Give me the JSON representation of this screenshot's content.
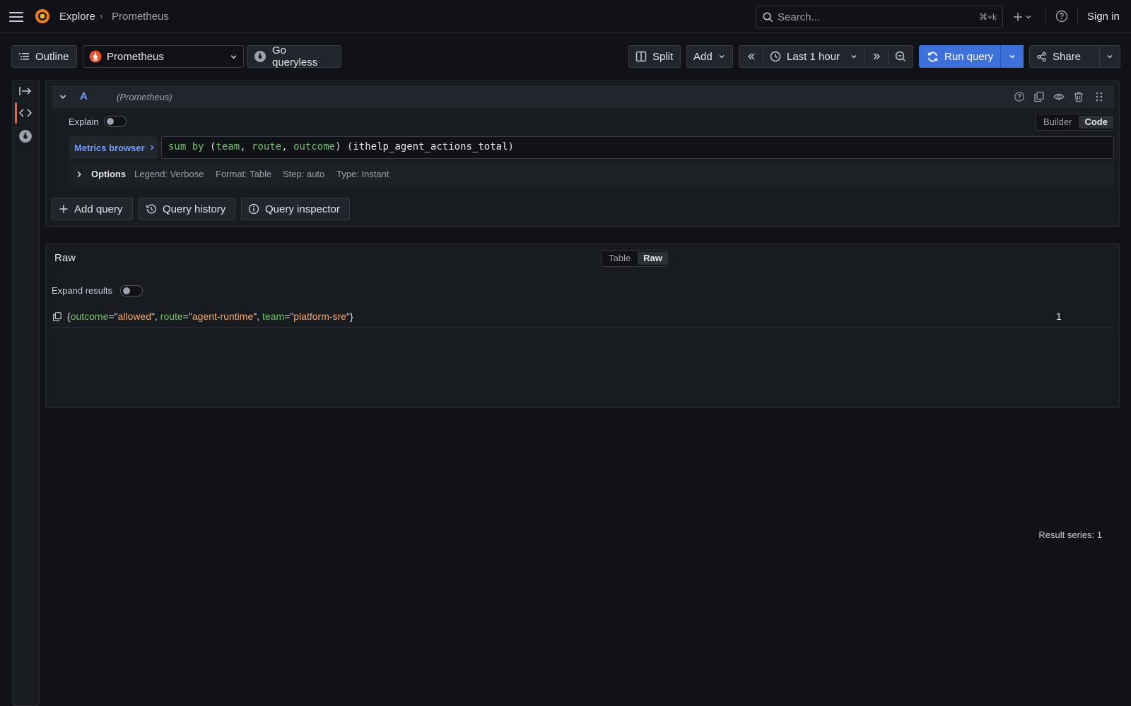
{
  "nav": {
    "breadcrumb": [
      "Explore",
      "Prometheus"
    ],
    "breadcrumb_sep": "›",
    "search_placeholder": "Search...",
    "search_shortcut": "⌘+k",
    "sign_in": "Sign in"
  },
  "toolbar": {
    "outline": "Outline",
    "datasource": "Prometheus",
    "go_queryless": "Go queryless",
    "split": "Split",
    "add": "Add",
    "time_range": "Last 1 hour",
    "run_query": "Run query",
    "share": "Share"
  },
  "query": {
    "ref_id": "A",
    "datasource_label": "(Prometheus)",
    "explain_label": "Explain",
    "editor_modes": [
      "Builder",
      "Code"
    ],
    "active_mode": "Code",
    "metrics_browser": "Metrics browser",
    "expr": {
      "fn": "sum",
      "kw": "by",
      "labels": [
        "team",
        "route",
        "outcome"
      ],
      "metric": "ithelp_agent_actions_total"
    },
    "options": {
      "title": "Options",
      "legend": "Legend: Verbose",
      "format": "Format: Table",
      "step": "Step: auto",
      "type": "Type: Instant"
    }
  },
  "actions": {
    "add_query": "Add query",
    "query_history": "Query history",
    "query_inspector": "Query inspector"
  },
  "results": {
    "title": "Raw",
    "view_modes": [
      "Table",
      "Raw"
    ],
    "active_view": "Raw",
    "expand_label": "Expand results",
    "series_count": "Result series: 1",
    "series": [
      {
        "labels": [
          {
            "key": "outcome",
            "value": "allowed"
          },
          {
            "key": "route",
            "value": "agent-runtime"
          },
          {
            "key": "team",
            "value": "platform-sre"
          }
        ],
        "value": "1"
      }
    ]
  },
  "colors": {
    "accent": "#3d71d9",
    "brand": "#f55f3e",
    "label_key": "#73bf69",
    "label_value": "#f0a774",
    "link": "#6e9fff"
  }
}
